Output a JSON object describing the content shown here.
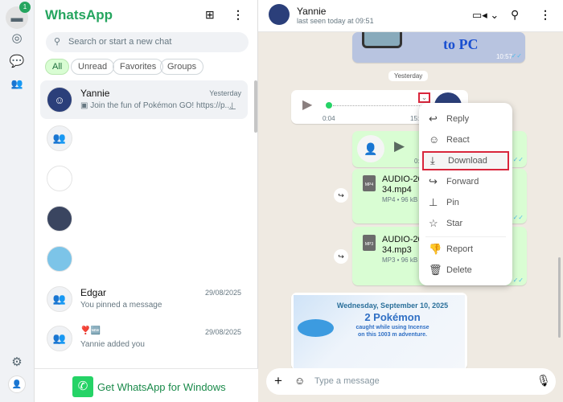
{
  "rail": {
    "badge": "1",
    "icons": [
      "chats-icon",
      "status-icon",
      "channels-icon",
      "communities-icon",
      "settings-icon",
      "profile-icon"
    ]
  },
  "list": {
    "title": "WhatsApp",
    "search_placeholder": "Search or start a new chat",
    "filters": [
      "All",
      "Unread",
      "Favorites",
      "Groups"
    ],
    "banner": "Get WhatsApp for Windows",
    "chats": [
      {
        "name": "Yannie",
        "time": "Yesterday",
        "preview": "Join the fun of Pokémon GO! https://p..."
      },
      {
        "name": "Edgar",
        "time": "29/08/2025",
        "preview": "You pinned a message"
      },
      {
        "name": "❣️🆕",
        "time": "29/08/2025",
        "preview": "Yannie added you"
      }
    ]
  },
  "chat": {
    "name": "Yannie",
    "status": "last seen today at 09:51",
    "image_caption": "to PC",
    "image_time": "10:57",
    "date_divider": "Yesterday",
    "audio": {
      "elapsed": "0:04",
      "time": "15:1"
    },
    "voice": {
      "elapsed": "0:"
    },
    "files": [
      {
        "name": "AUDIO-202",
        "name2": "34.mp4",
        "meta": "MP4 • 96 kB",
        "type": "MP4"
      },
      {
        "name": "AUDIO-202",
        "name2": "34.mp3",
        "meta": "MP3 • 96 kB",
        "type": "MP3"
      }
    ],
    "pokemon": {
      "date": "Wednesday, September 10, 2025",
      "title": "2 Pokémon",
      "line1": "caught while using Incense",
      "line2": "on this 1003 m adventure."
    },
    "input_placeholder": "Type a message"
  },
  "menu": {
    "items": [
      "Reply",
      "React",
      "Download",
      "Forward",
      "Pin",
      "Star",
      "Report",
      "Delete"
    ],
    "highlighted": "Download"
  },
  "colors": {
    "accent": "#25a55f",
    "outgoing": "#d9fdd3",
    "highlight_border": "#d9263c"
  }
}
